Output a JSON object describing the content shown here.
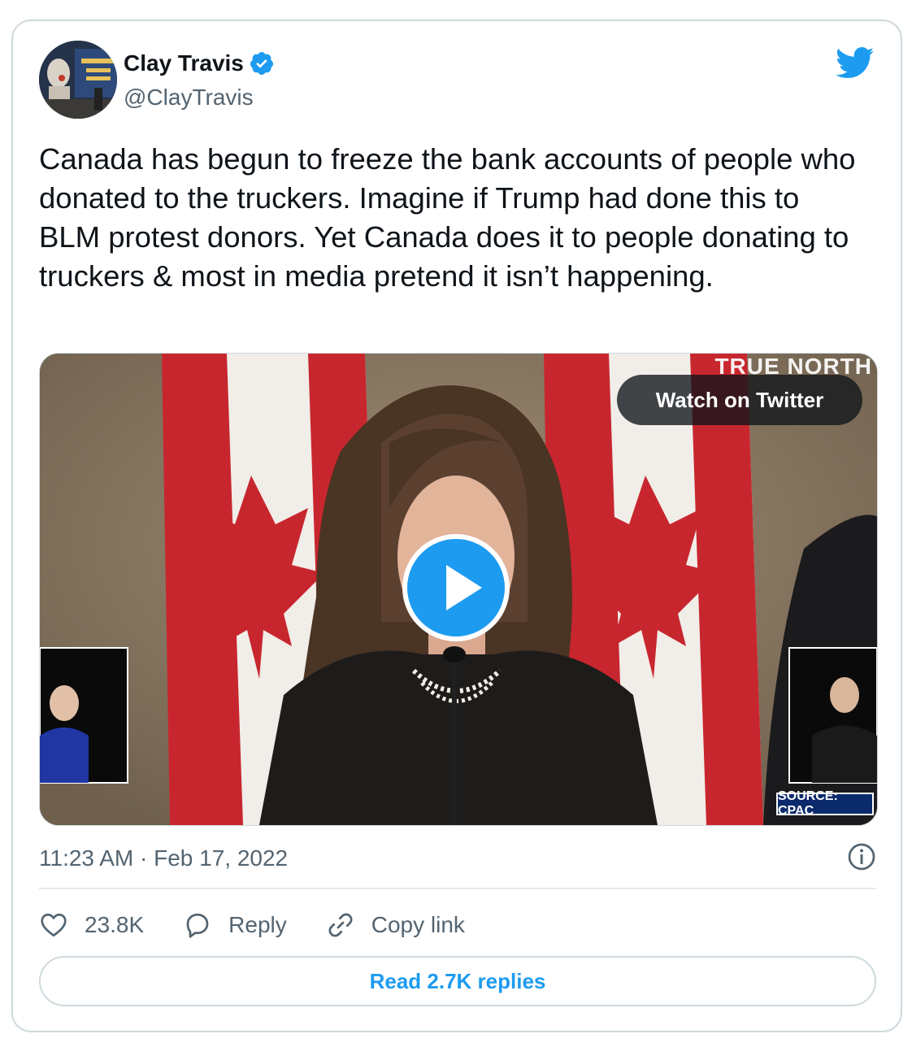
{
  "author": {
    "name": "Clay Travis",
    "handle": "@ClayTravis",
    "verified": true,
    "avatar_icon": "profile-photo"
  },
  "tweet": {
    "text": "Canada has begun to freeze the bank accounts of people who donated to the truckers. Imagine if Trump had done this to BLM protest donors. Yet Canada does it to people donating to truckers & most in media pretend it isn’t happening.",
    "timestamp": "11:23 AM · Feb 17, 2022"
  },
  "media": {
    "type": "video",
    "watch_label": "Watch on Twitter",
    "brand_label": "TRUE NORTH",
    "source_label": "SOURCE: CPAC"
  },
  "actions": {
    "like_count": "23.8K",
    "reply_label": "Reply",
    "copy_label": "Copy link",
    "read_replies_label": "Read 2.7K replies"
  },
  "colors": {
    "accent": "#1d9bf0",
    "text": "#0f1419",
    "muted": "#536471",
    "border": "#cfd9de"
  },
  "icons": [
    "twitter-bird-icon",
    "verified-badge-icon",
    "play-icon",
    "info-icon",
    "heart-icon",
    "reply-icon",
    "link-icon"
  ]
}
